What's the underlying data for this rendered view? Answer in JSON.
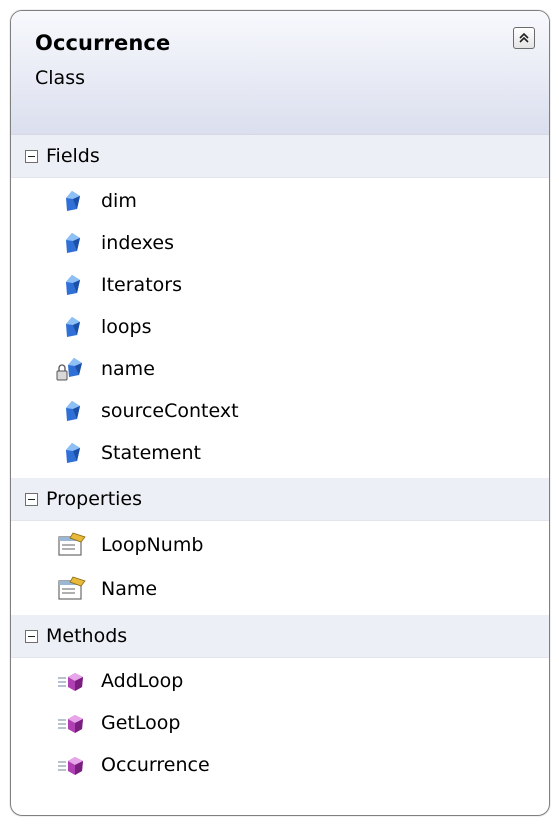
{
  "shape": {
    "title": "Occurrence",
    "subtitle": "Class",
    "collapse_icon": "double-chevron-up-icon"
  },
  "sections": {
    "fields": {
      "label": "Fields",
      "items": [
        "dim",
        "indexes",
        "Iterators",
        "loops",
        "name",
        "sourceContext",
        "Statement"
      ],
      "icon": "field-icon",
      "private_icon": "private-field-icon"
    },
    "properties": {
      "label": "Properties",
      "items": [
        "LoopNumb",
        "Name"
      ],
      "icon": "property-icon"
    },
    "methods": {
      "label": "Methods",
      "items": [
        "AddLoop",
        "GetLoop",
        "Occurrence"
      ],
      "icon": "method-icon"
    }
  },
  "colors": {
    "field": "#2f6fd6",
    "method": "#b03fb3",
    "header_gradient_top": "#f8f9fd",
    "header_gradient_bottom": "#dbdfee",
    "section_header": "#eceff6"
  }
}
